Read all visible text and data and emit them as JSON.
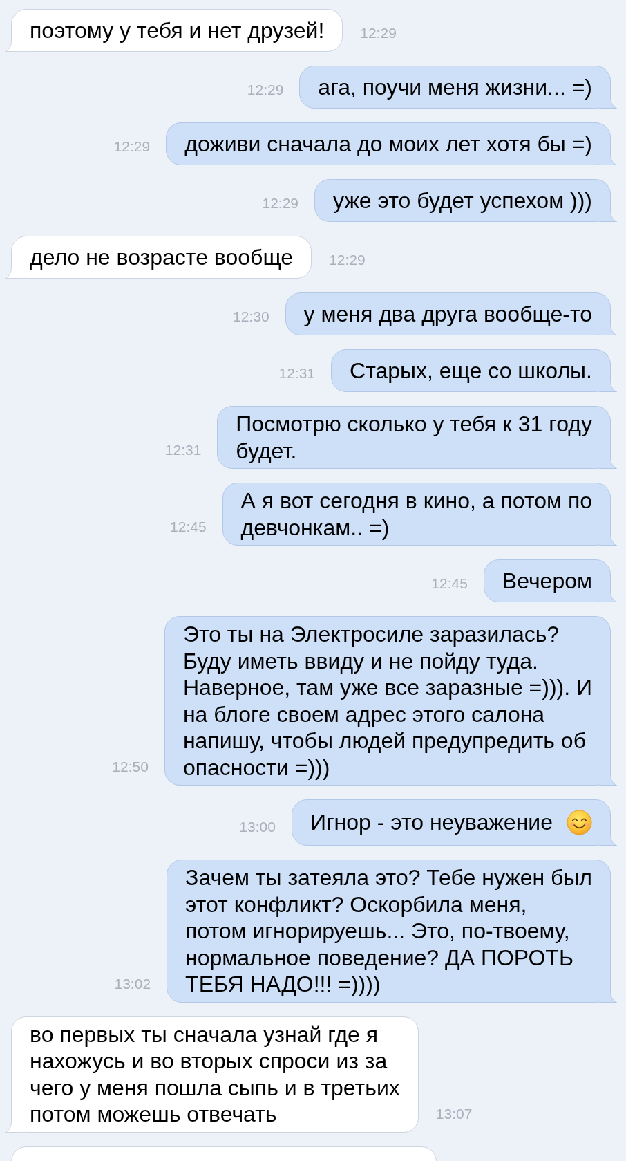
{
  "messages": [
    {
      "kind": "incoming",
      "text": "поэтому у тебя и нет друзей!",
      "time": "12:29"
    },
    {
      "kind": "outgoing",
      "text": "ага, поучи меня жизни... =)",
      "time": "12:29"
    },
    {
      "kind": "outgoing",
      "text": "доживи сначала до моих лет хотя бы =)",
      "time": "12:29"
    },
    {
      "kind": "outgoing",
      "text": "уже это будет успехом )))",
      "time": "12:29"
    },
    {
      "kind": "incoming",
      "text": "дело не возрасте вообще",
      "time": "12:29"
    },
    {
      "kind": "outgoing",
      "text": "у меня два друга вообще-то",
      "time": "12:30"
    },
    {
      "kind": "outgoing",
      "text": "Старых, еще со школы.",
      "time": "12:31"
    },
    {
      "kind": "outgoing",
      "text": "Посмотрю сколько у тебя к 31 году\nбудет.",
      "time": "12:31"
    },
    {
      "kind": "outgoing",
      "text": "А я вот сегодня в кино, а потом по\nдевчонкам.. =)",
      "time": "12:45"
    },
    {
      "kind": "outgoing",
      "text": "Вечером",
      "time": "12:45"
    },
    {
      "kind": "outgoing",
      "text": "Это ты на Электросиле заразилась?\nБуду иметь ввиду и не пойду туда.\nНаверное, там уже все заразные =))). И\nна блоге своем адрес этого салона\nнапишу, чтобы людей предупредить об\nопасности =)))",
      "time": "12:50"
    },
    {
      "kind": "outgoing",
      "text": "Игнор - это неуважение",
      "emoji": true,
      "time": "13:00"
    },
    {
      "kind": "outgoing",
      "text": "Зачем ты затеяла это? Тебе нужен был\nэтот конфликт? Оскорбила меня,\nпотом игнорируешь... Это, по-твоему,\nнормальное поведение? ДА ПОРОТЬ\nТЕБЯ НАДО!!! =))))",
      "time": "13:02"
    },
    {
      "kind": "incoming",
      "text": "во первых ты сначала узнай где я\nнахожусь и во вторых спроси из за\nчего у меня пошла сыпь и в третьих\nпотом можешь отвечать",
      "time": "13:07"
    },
    {
      "kind": "incoming"
    }
  ]
}
